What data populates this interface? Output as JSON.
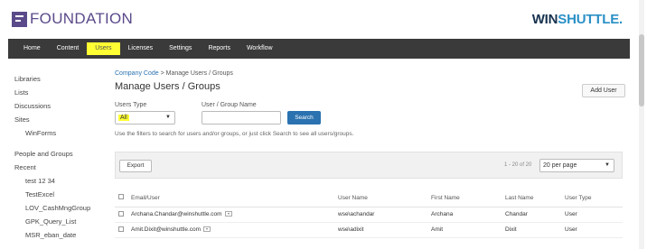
{
  "brand": {
    "name": "FOUNDATION",
    "partner_win": "WIN",
    "partner_shuttle": "SHUTTLE",
    "partner_dot": "."
  },
  "nav": {
    "items": [
      "Home",
      "Content",
      "Users",
      "Licenses",
      "Settings",
      "Reports",
      "Workflow"
    ],
    "active_index": 2
  },
  "sidebar": {
    "group1": [
      "Libraries",
      "Lists",
      "Discussions",
      "Sites"
    ],
    "sites_sub": [
      "WinForms"
    ],
    "group2": [
      "People and Groups",
      "Recent"
    ],
    "recent_sub": [
      "test 12 34",
      "TestExcel",
      "LOV_CashMngGroup",
      "GPK_Query_List",
      "MSR_eban_date"
    ]
  },
  "breadcrumb": {
    "link": "Company Code",
    "rest": " > Manage Users / Groups"
  },
  "page_title": "Manage Users / Groups",
  "add_user_label": "Add User",
  "filters": {
    "users_type_label": "Users Type",
    "users_type_value": "All",
    "name_label": "User / Group Name",
    "name_value": "",
    "search_label": "Search",
    "hint": "Use the filters to search for users and/or groups, or just click Search to see all users/groups."
  },
  "toolbar": {
    "export_label": "Export",
    "range": "1 - 20 of 20",
    "per_page": "20 per page"
  },
  "table": {
    "headers": [
      "Email/User",
      "User Name",
      "First Name",
      "Last Name",
      "User Type"
    ],
    "rows": [
      {
        "email": "Archana.Chandar@winshuttle.com",
        "username": "wse\\achandar",
        "first": "Archana",
        "last": "Chandar",
        "type": "User"
      },
      {
        "email": "Amit.Dixit@winshuttle.com",
        "username": "wse\\adixit",
        "first": "Amit",
        "last": "Dixit",
        "type": "User"
      }
    ]
  },
  "colors": {
    "brand": "#5b4a8a",
    "nav_bg": "#3a3a3a",
    "highlight": "#ffff33",
    "primary_button": "#2a72b0"
  }
}
